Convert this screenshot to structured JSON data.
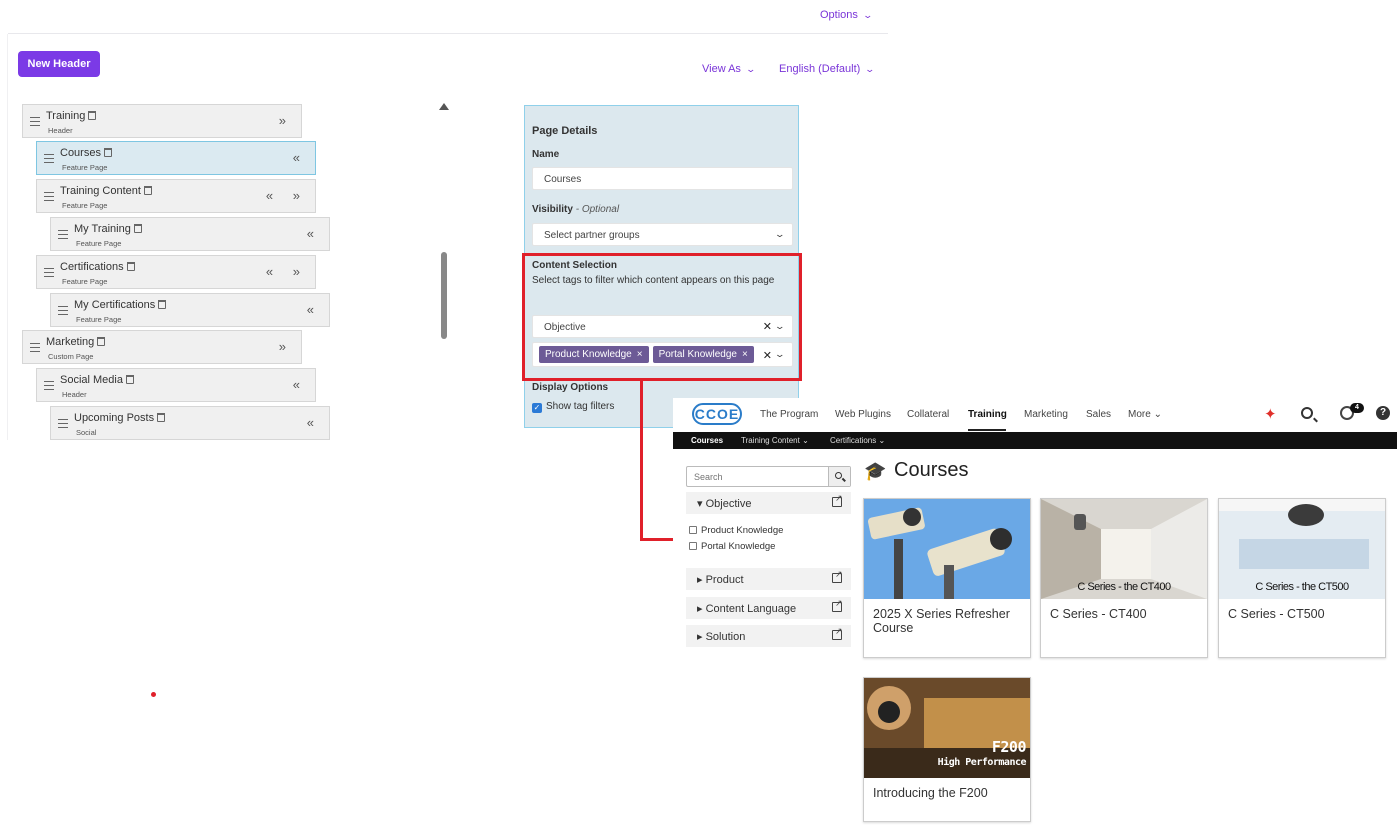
{
  "admin": {
    "options": "Options",
    "new_header": "New Header",
    "view_as": "View As",
    "language": "English (Default)"
  },
  "tree": [
    {
      "name": "Training",
      "type": "Header"
    },
    {
      "name": "Courses",
      "type": "Feature Page"
    },
    {
      "name": "Training Content",
      "type": "Feature Page"
    },
    {
      "name": "My Training",
      "type": "Feature Page"
    },
    {
      "name": "Certifications",
      "type": "Feature Page"
    },
    {
      "name": "My Certifications",
      "type": "Feature Page"
    },
    {
      "name": "Marketing",
      "type": "Custom Page"
    },
    {
      "name": "Social Media",
      "type": "Header"
    },
    {
      "name": "Upcoming Posts",
      "type": "Social"
    }
  ],
  "details": {
    "heading": "Page Details",
    "name_label": "Name",
    "name_value": "Courses",
    "visibility_label": "Visibility",
    "visibility_optional": "- Optional",
    "visibility_placeholder": "Select partner groups",
    "content_label": "Content Selection",
    "content_help": "Select tags to filter which content appears on this page",
    "objective_value": "Objective",
    "tags": [
      "Product Knowledge",
      "Portal Knowledge"
    ],
    "display_label": "Display Options",
    "show_tags": "Show tag filters"
  },
  "portal": {
    "logo": "CCOE",
    "nav": [
      "The Program",
      "Web Plugins",
      "Collateral",
      "Training",
      "Marketing",
      "Sales",
      "More"
    ],
    "badge_count": "4",
    "subnav": [
      "Courses",
      "Training Content",
      "Certifications"
    ],
    "search_placeholder": "Search",
    "facets": {
      "objective": "Objective",
      "objective_options": [
        "Product Knowledge",
        "Portal Knowledge"
      ],
      "product": "Product",
      "content_language": "Content Language",
      "solution": "Solution"
    },
    "page_title": "Courses",
    "cards": [
      {
        "title": "2025 X Series Refresher Course",
        "overlay": ""
      },
      {
        "title": "C Series - CT400",
        "overlay": "C Series - the CT400"
      },
      {
        "title": "C Series - CT500",
        "overlay": "C Series - the CT500"
      },
      {
        "title": "Introducing the F200",
        "overlay": "F200",
        "overlay2": "High Performance"
      }
    ]
  },
  "colors": {
    "accent": "#7b3ae6",
    "highlight": "#e0202a",
    "tag": "#6c5a96"
  }
}
